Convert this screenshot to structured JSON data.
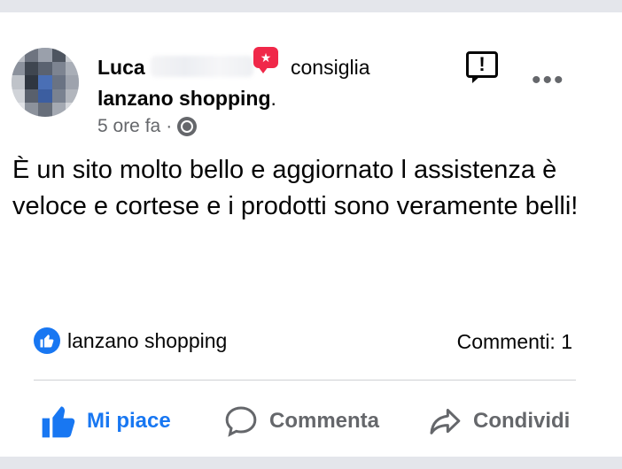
{
  "post": {
    "author": "Luca",
    "verb": "consiglia",
    "page": "lanzano shopping",
    "page_suffix": ".",
    "timestamp": "5 ore fa",
    "separator": "·",
    "privacy_icon": "globe-icon",
    "body": "È un sito molto bello e aggiornato l assistenza è veloce e cortese e i prodotti sono veramente belli!"
  },
  "stats": {
    "reaction_name": "lanzano shopping",
    "comments": "Commenti: 1"
  },
  "actions": {
    "like": "Mi piace",
    "comment": "Commenta",
    "share": "Condividi"
  },
  "icons": {
    "recommend": "star-badge-icon",
    "report": "report-icon",
    "more": "more-options-icon"
  },
  "colors": {
    "accent": "#1877f2",
    "badge": "#f02849",
    "muted": "#65676b"
  }
}
